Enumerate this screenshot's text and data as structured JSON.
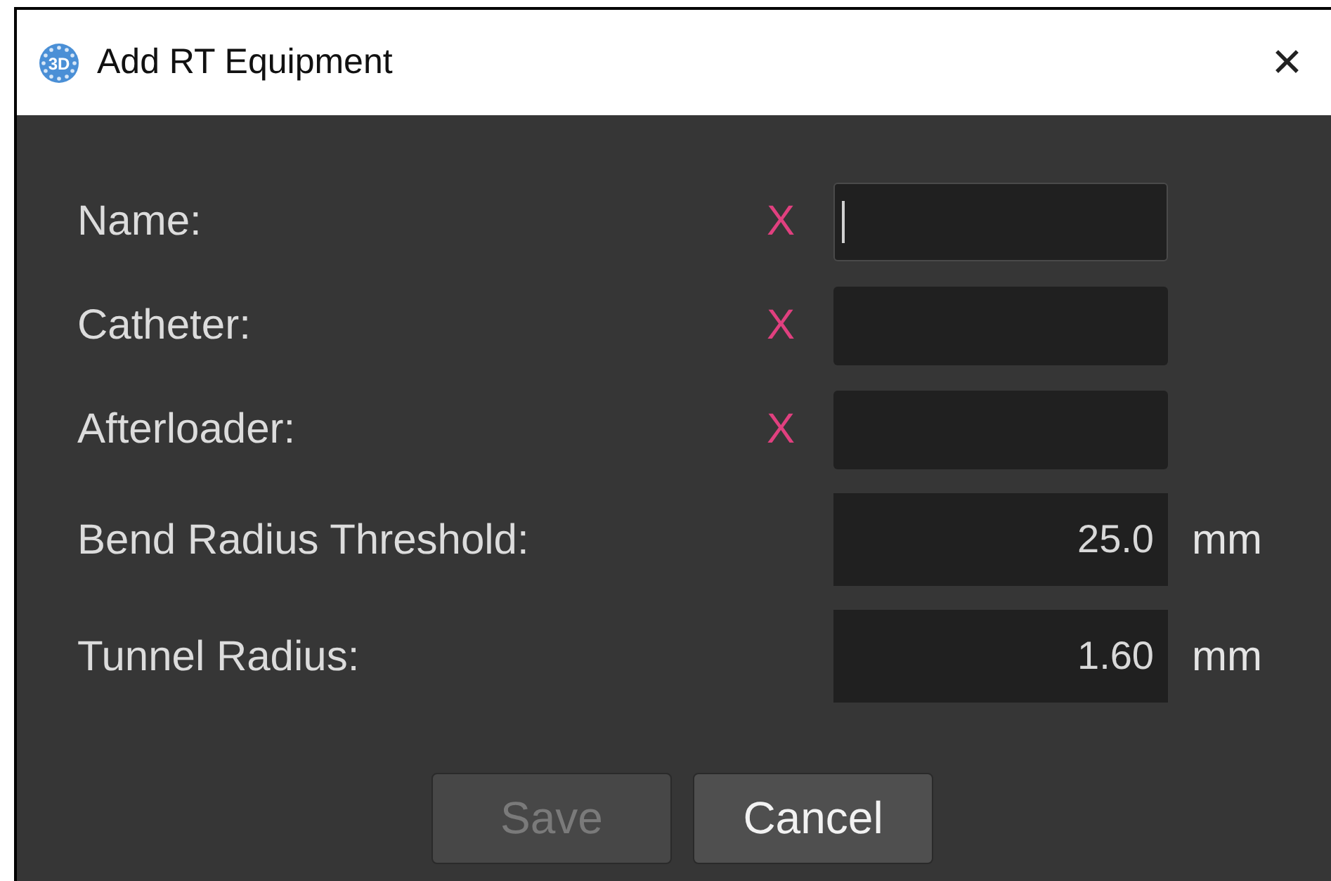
{
  "window": {
    "title": "Add RT Equipment",
    "icon_label": "3D",
    "close": "✕"
  },
  "fields": [
    {
      "label": "Name:",
      "kind": "text",
      "required_mark": "X",
      "focused": true
    },
    {
      "label": "Catheter:",
      "kind": "text",
      "required_mark": "X",
      "focused": false
    },
    {
      "label": "Afterloader:",
      "kind": "text",
      "required_mark": "X",
      "focused": false
    },
    {
      "label": "Bend Radius Threshold:",
      "kind": "number",
      "value": "25.0",
      "unit": "mm",
      "focused": false
    },
    {
      "label": "Tunnel Radius:",
      "kind": "number",
      "value": "1.60",
      "unit": "mm",
      "focused": false
    }
  ],
  "buttons": [
    {
      "label": "Save",
      "disabled": true
    },
    {
      "label": "Cancel",
      "disabled": false
    }
  ]
}
